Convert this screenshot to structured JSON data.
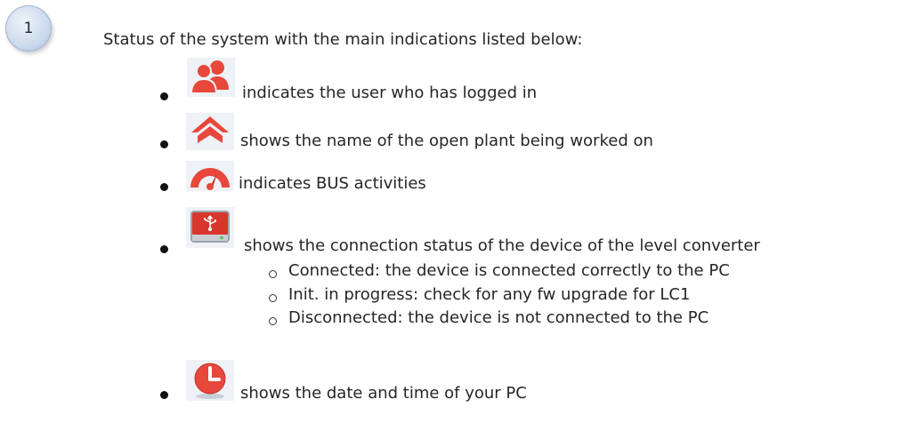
{
  "step": {
    "number": "1"
  },
  "intro": "Status of the system with the main indications listed below:",
  "items": [
    {
      "icon": "users-icon",
      "text": "indicates the user who has logged in"
    },
    {
      "icon": "home-icon",
      "text": "shows the name of the open plant being worked on"
    },
    {
      "icon": "gauge-icon",
      "text": "indicates BUS activities"
    },
    {
      "icon": "usb-drive-icon",
      "text": "shows the connection status of the device of the level converter",
      "subitems": [
        "Connected: the device is connected correctly to the PC",
        "Init. in progress: check for any fw upgrade for LC1",
        "Disconnected: the device is not connected to the PC"
      ]
    },
    {
      "icon": "clock-icon",
      "text": "shows the date and time of your PC"
    }
  ],
  "colors": {
    "icon_red": "#e8473c",
    "icon_bg": "#eef2f6",
    "badge_fill": "#c9d8ec"
  }
}
